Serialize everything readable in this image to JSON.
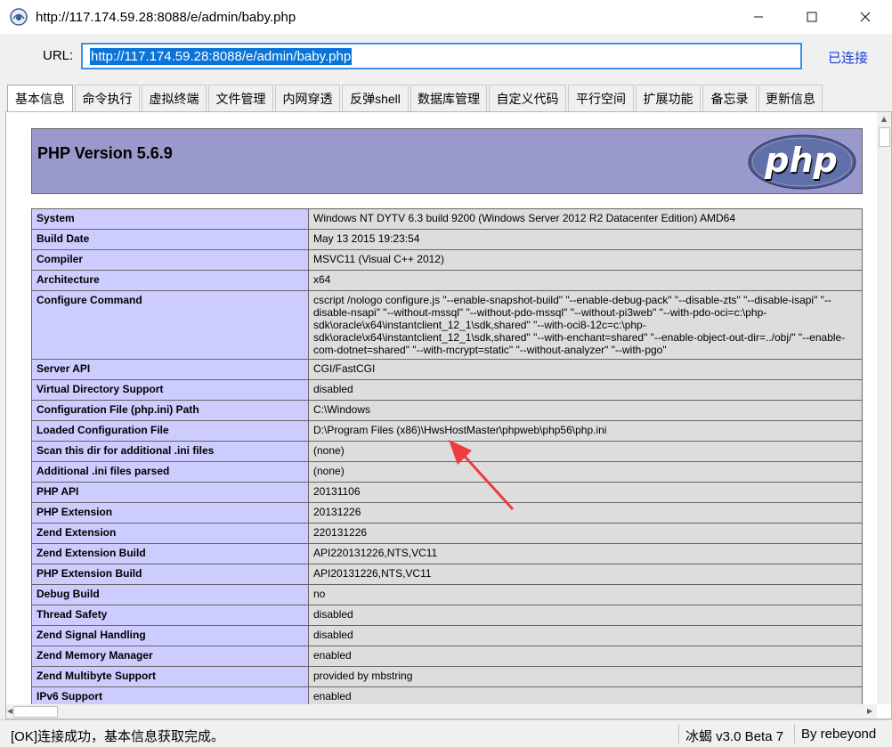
{
  "window": {
    "title": "http://117.174.59.28:8088/e/admin/baby.php",
    "minimize_icon": "minimize-icon",
    "maximize_icon": "maximize-icon",
    "close_icon": "close-icon"
  },
  "urlbar": {
    "label": "URL:",
    "value": "http://117.174.59.28:8088/e/admin/baby.php",
    "status": "已连接"
  },
  "tabs": [
    {
      "label": "基本信息",
      "active": true
    },
    {
      "label": "命令执行"
    },
    {
      "label": "虚拟终端"
    },
    {
      "label": "文件管理"
    },
    {
      "label": "内网穿透"
    },
    {
      "label": "反弹shell"
    },
    {
      "label": "数据库管理"
    },
    {
      "label": "自定义代码"
    },
    {
      "label": "平行空间"
    },
    {
      "label": "扩展功能"
    },
    {
      "label": "备忘录"
    },
    {
      "label": "更新信息"
    }
  ],
  "phpinfo": {
    "version": "PHP Version 5.6.9",
    "logo_text": "php",
    "rows": [
      {
        "key": "System",
        "value": "Windows NT DYTV 6.3 build 9200 (Windows Server 2012 R2 Datacenter Edition) AMD64"
      },
      {
        "key": "Build Date",
        "value": "May 13 2015 19:23:54"
      },
      {
        "key": "Compiler",
        "value": "MSVC11 (Visual C++ 2012)"
      },
      {
        "key": "Architecture",
        "value": "x64"
      },
      {
        "key": "Configure Command",
        "value": "cscript /nologo configure.js \"--enable-snapshot-build\" \"--enable-debug-pack\" \"--disable-zts\" \"--disable-isapi\" \"--disable-nsapi\" \"--without-mssql\" \"--without-pdo-mssql\" \"--without-pi3web\" \"--with-pdo-oci=c:\\php-sdk\\oracle\\x64\\instantclient_12_1\\sdk,shared\" \"--with-oci8-12c=c:\\php-sdk\\oracle\\x64\\instantclient_12_1\\sdk,shared\" \"--with-enchant=shared\" \"--enable-object-out-dir=../obj/\" \"--enable-com-dotnet=shared\" \"--with-mcrypt=static\" \"--without-analyzer\" \"--with-pgo\""
      },
      {
        "key": "Server API",
        "value": "CGI/FastCGI"
      },
      {
        "key": "Virtual Directory Support",
        "value": "disabled"
      },
      {
        "key": "Configuration File (php.ini) Path",
        "value": "C:\\Windows"
      },
      {
        "key": "Loaded Configuration File",
        "value": "D:\\Program Files (x86)\\HwsHostMaster\\phpweb\\php56\\php.ini"
      },
      {
        "key": "Scan this dir for additional .ini files",
        "value": "(none)"
      },
      {
        "key": "Additional .ini files parsed",
        "value": "(none)"
      },
      {
        "key": "PHP API",
        "value": "20131106"
      },
      {
        "key": "PHP Extension",
        "value": "20131226"
      },
      {
        "key": "Zend Extension",
        "value": "220131226"
      },
      {
        "key": "Zend Extension Build",
        "value": "API220131226,NTS,VC11"
      },
      {
        "key": "PHP Extension Build",
        "value": "API20131226,NTS,VC11"
      },
      {
        "key": "Debug Build",
        "value": "no"
      },
      {
        "key": "Thread Safety",
        "value": "disabled"
      },
      {
        "key": "Zend Signal Handling",
        "value": "disabled"
      },
      {
        "key": "Zend Memory Manager",
        "value": "enabled"
      },
      {
        "key": "Zend Multibyte Support",
        "value": "provided by mbstring"
      },
      {
        "key": "IPv6 Support",
        "value": "enabled"
      }
    ]
  },
  "statusbar": {
    "message": "[OK]连接成功，基本信息获取完成。",
    "version": "冰蝎 v3.0 Beta 7",
    "author": "By rebeyond"
  },
  "colors": {
    "php_header_bg": "#9999cc",
    "key_cell_bg": "#ccccff",
    "value_cell_bg": "#dddddd",
    "url_highlight": "#0a74d8",
    "connected_text": "#1a3edb",
    "annotation_arrow": "#f03c3c"
  }
}
